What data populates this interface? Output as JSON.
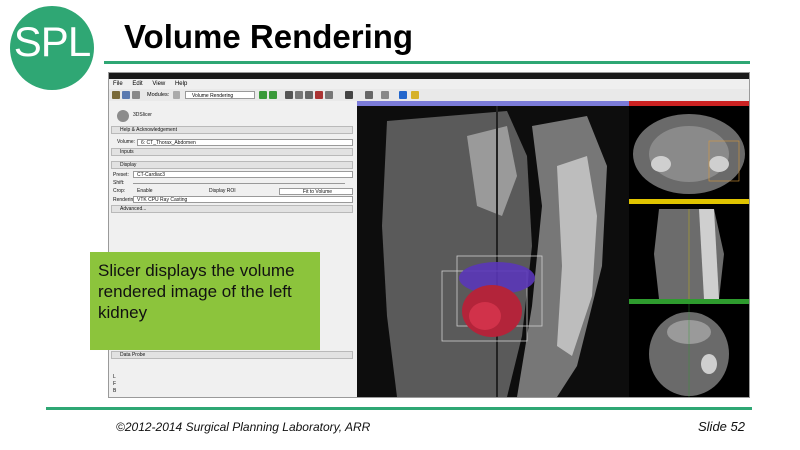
{
  "slide": {
    "logo_text": "SPL",
    "title": "Volume Rendering",
    "callout": "Slicer displays the volume rendered image of the left kidney",
    "copyright": "©2012-2014 Surgical Planning Laboratory, ARR",
    "slide_number": "Slide 52",
    "colors": {
      "accent": "#2fa774",
      "callout_bg": "#8cc43c"
    }
  },
  "app": {
    "menu": [
      "File",
      "Edit",
      "View",
      "Help"
    ],
    "modules_label": "Modules:",
    "module_selected": "Volume Rendering",
    "logo_label": "3DSlicer",
    "sections": {
      "help": "Help & Acknowledgement",
      "inputs": "Inputs",
      "display": "Display",
      "advanced": "Advanced...",
      "data_probe": "Data Probe"
    },
    "volume_label": "Volume:",
    "volume_value": "6: CT_Thorax_Abdomen",
    "preset_label": "Preset:",
    "preset_value": "CT-Cardiac3",
    "shift_label": "Shift:",
    "crop_label": "Crop:",
    "enable_label": "Enable",
    "display_roi_label": "Display ROI",
    "fit_to_volume_label": "Fit to Volume",
    "rendering_label": "Rendering:",
    "rendering_value": "VTK CPU Ray Casting",
    "probe_lines": [
      "L",
      "F",
      "B"
    ]
  }
}
